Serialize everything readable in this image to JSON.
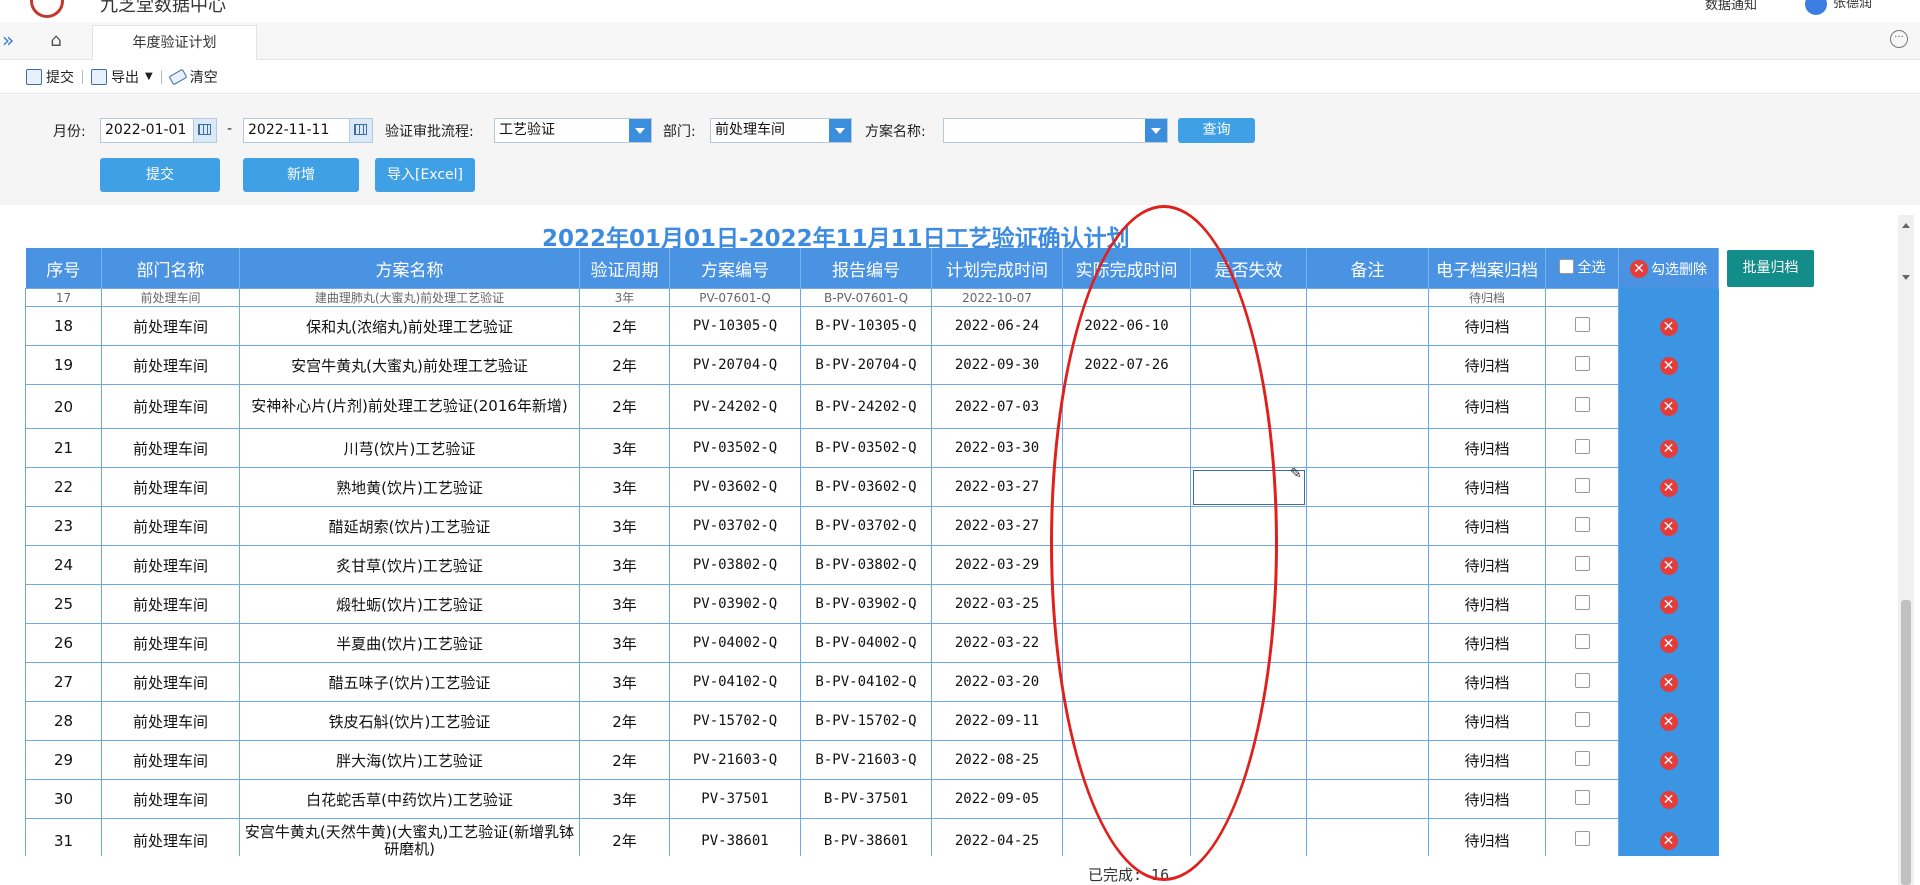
{
  "header": {
    "app_title": "九芝堂数据中心",
    "top_right_link": "数据通知",
    "user_name": "张德润"
  },
  "tabs": {
    "active_label": "年度验证计划"
  },
  "toolbar": {
    "submit": "提交",
    "export": "导出",
    "clear": "清空"
  },
  "filter": {
    "month_label": "月份:",
    "date_from": "2022-01-01",
    "date_sep": "-",
    "date_to": "2022-11-11",
    "flow_label": "验证审批流程:",
    "flow_value": "工艺验证",
    "dept_label": "部门:",
    "dept_value": "前处理车间",
    "plan_label": "方案名称:",
    "plan_value": "",
    "query_button": "查询",
    "submit_button": "提交",
    "add_button": "新增",
    "import_button": "导入[Excel]"
  },
  "report_title": "2022年01月01日-2022年11月11日工艺验证确认计划",
  "table": {
    "headers": [
      "序号",
      "部门名称",
      "方案名称",
      "验证周期",
      "方案编号",
      "报告编号",
      "计划完成时间",
      "实际完成时间",
      "是否失效",
      "备注",
      "电子档案归档",
      "全选",
      "勾选删除"
    ],
    "partial_row": [
      "17",
      "前处理车间",
      "建曲理肺丸(大蜜丸)前处理工艺验证",
      "3年",
      "PV-07601-Q",
      "B-PV-07601-Q",
      "2022-10-07",
      "",
      "",
      "",
      "待归档"
    ],
    "rows": [
      {
        "no": "18",
        "dept": "前处理车间",
        "name": "保和丸(浓缩丸)前处理工艺验证",
        "cycle": "2年",
        "plan_no": "PV-10305-Q",
        "report_no": "B-PV-10305-Q",
        "planned": "2022-06-24",
        "actual": "2022-06-10",
        "invalid": "",
        "note": "",
        "archive": "待归档"
      },
      {
        "no": "19",
        "dept": "前处理车间",
        "name": "安宫牛黄丸(大蜜丸)前处理工艺验证",
        "cycle": "2年",
        "plan_no": "PV-20704-Q",
        "report_no": "B-PV-20704-Q",
        "planned": "2022-09-30",
        "actual": "2022-07-26",
        "invalid": "",
        "note": "",
        "archive": "待归档"
      },
      {
        "no": "20",
        "dept": "前处理车间",
        "name": "安神补心片(片剂)前处理工艺验证(2016年新增)",
        "cycle": "2年",
        "plan_no": "PV-24202-Q",
        "report_no": "B-PV-24202-Q",
        "planned": "2022-07-03",
        "actual": "",
        "invalid": "",
        "note": "",
        "archive": "待归档"
      },
      {
        "no": "21",
        "dept": "前处理车间",
        "name": "川芎(饮片)工艺验证",
        "cycle": "3年",
        "plan_no": "PV-03502-Q",
        "report_no": "B-PV-03502-Q",
        "planned": "2022-03-30",
        "actual": "",
        "invalid": "",
        "note": "",
        "archive": "待归档"
      },
      {
        "no": "22",
        "dept": "前处理车间",
        "name": "熟地黄(饮片)工艺验证",
        "cycle": "3年",
        "plan_no": "PV-03602-Q",
        "report_no": "B-PV-03602-Q",
        "planned": "2022-03-27",
        "actual": "",
        "invalid": "",
        "note": "",
        "archive": "待归档"
      },
      {
        "no": "23",
        "dept": "前处理车间",
        "name": "醋延胡索(饮片)工艺验证",
        "cycle": "3年",
        "plan_no": "PV-03702-Q",
        "report_no": "B-PV-03702-Q",
        "planned": "2022-03-27",
        "actual": "",
        "invalid": "",
        "note": "",
        "archive": "待归档"
      },
      {
        "no": "24",
        "dept": "前处理车间",
        "name": "炙甘草(饮片)工艺验证",
        "cycle": "3年",
        "plan_no": "PV-03802-Q",
        "report_no": "B-PV-03802-Q",
        "planned": "2022-03-29",
        "actual": "",
        "invalid": "",
        "note": "",
        "archive": "待归档"
      },
      {
        "no": "25",
        "dept": "前处理车间",
        "name": "煅牡蛎(饮片)工艺验证",
        "cycle": "3年",
        "plan_no": "PV-03902-Q",
        "report_no": "B-PV-03902-Q",
        "planned": "2022-03-25",
        "actual": "",
        "invalid": "",
        "note": "",
        "archive": "待归档"
      },
      {
        "no": "26",
        "dept": "前处理车间",
        "name": "半夏曲(饮片)工艺验证",
        "cycle": "3年",
        "plan_no": "PV-04002-Q",
        "report_no": "B-PV-04002-Q",
        "planned": "2022-03-22",
        "actual": "",
        "invalid": "",
        "note": "",
        "archive": "待归档"
      },
      {
        "no": "27",
        "dept": "前处理车间",
        "name": "醋五味子(饮片)工艺验证",
        "cycle": "3年",
        "plan_no": "PV-04102-Q",
        "report_no": "B-PV-04102-Q",
        "planned": "2022-03-20",
        "actual": "",
        "invalid": "",
        "note": "",
        "archive": "待归档"
      },
      {
        "no": "28",
        "dept": "前处理车间",
        "name": "铁皮石斛(饮片)工艺验证",
        "cycle": "2年",
        "plan_no": "PV-15702-Q",
        "report_no": "B-PV-15702-Q",
        "planned": "2022-09-11",
        "actual": "",
        "invalid": "",
        "note": "",
        "archive": "待归档"
      },
      {
        "no": "29",
        "dept": "前处理车间",
        "name": "胖大海(饮片)工艺验证",
        "cycle": "2年",
        "plan_no": "PV-21603-Q",
        "report_no": "B-PV-21603-Q",
        "planned": "2022-08-25",
        "actual": "",
        "invalid": "",
        "note": "",
        "archive": "待归档"
      },
      {
        "no": "30",
        "dept": "前处理车间",
        "name": "白花蛇舌草(中药饮片)工艺验证",
        "cycle": "3年",
        "plan_no": "PV-37501",
        "report_no": "B-PV-37501",
        "planned": "2022-09-05",
        "actual": "",
        "invalid": "",
        "note": "",
        "archive": "待归档"
      },
      {
        "no": "31",
        "dept": "前处理车间",
        "name": "安宫牛黄丸(天然牛黄)(大蜜丸)工艺验证(新增乳钵研磨机)",
        "cycle": "2年",
        "plan_no": "PV-38601",
        "report_no": "B-PV-38601",
        "planned": "2022-04-25",
        "actual": "",
        "invalid": "",
        "note": "",
        "archive": "待归档"
      }
    ],
    "batch_archive_button": "批量归档",
    "delete_symbol": "✕"
  },
  "summary": "已完成: 16",
  "colors": {
    "header_blue": "#4a93e3",
    "delete_red": "#e43b3b",
    "batch_teal": "#138d8a",
    "annotation_red": "#e0201b"
  },
  "icons": [
    "expand-icon",
    "home-icon",
    "more-icon",
    "save-icon",
    "export-icon",
    "clear-icon",
    "calendar-icon",
    "dropdown-arrow-icon",
    "delete-icon",
    "edit-pencil-icon"
  ]
}
